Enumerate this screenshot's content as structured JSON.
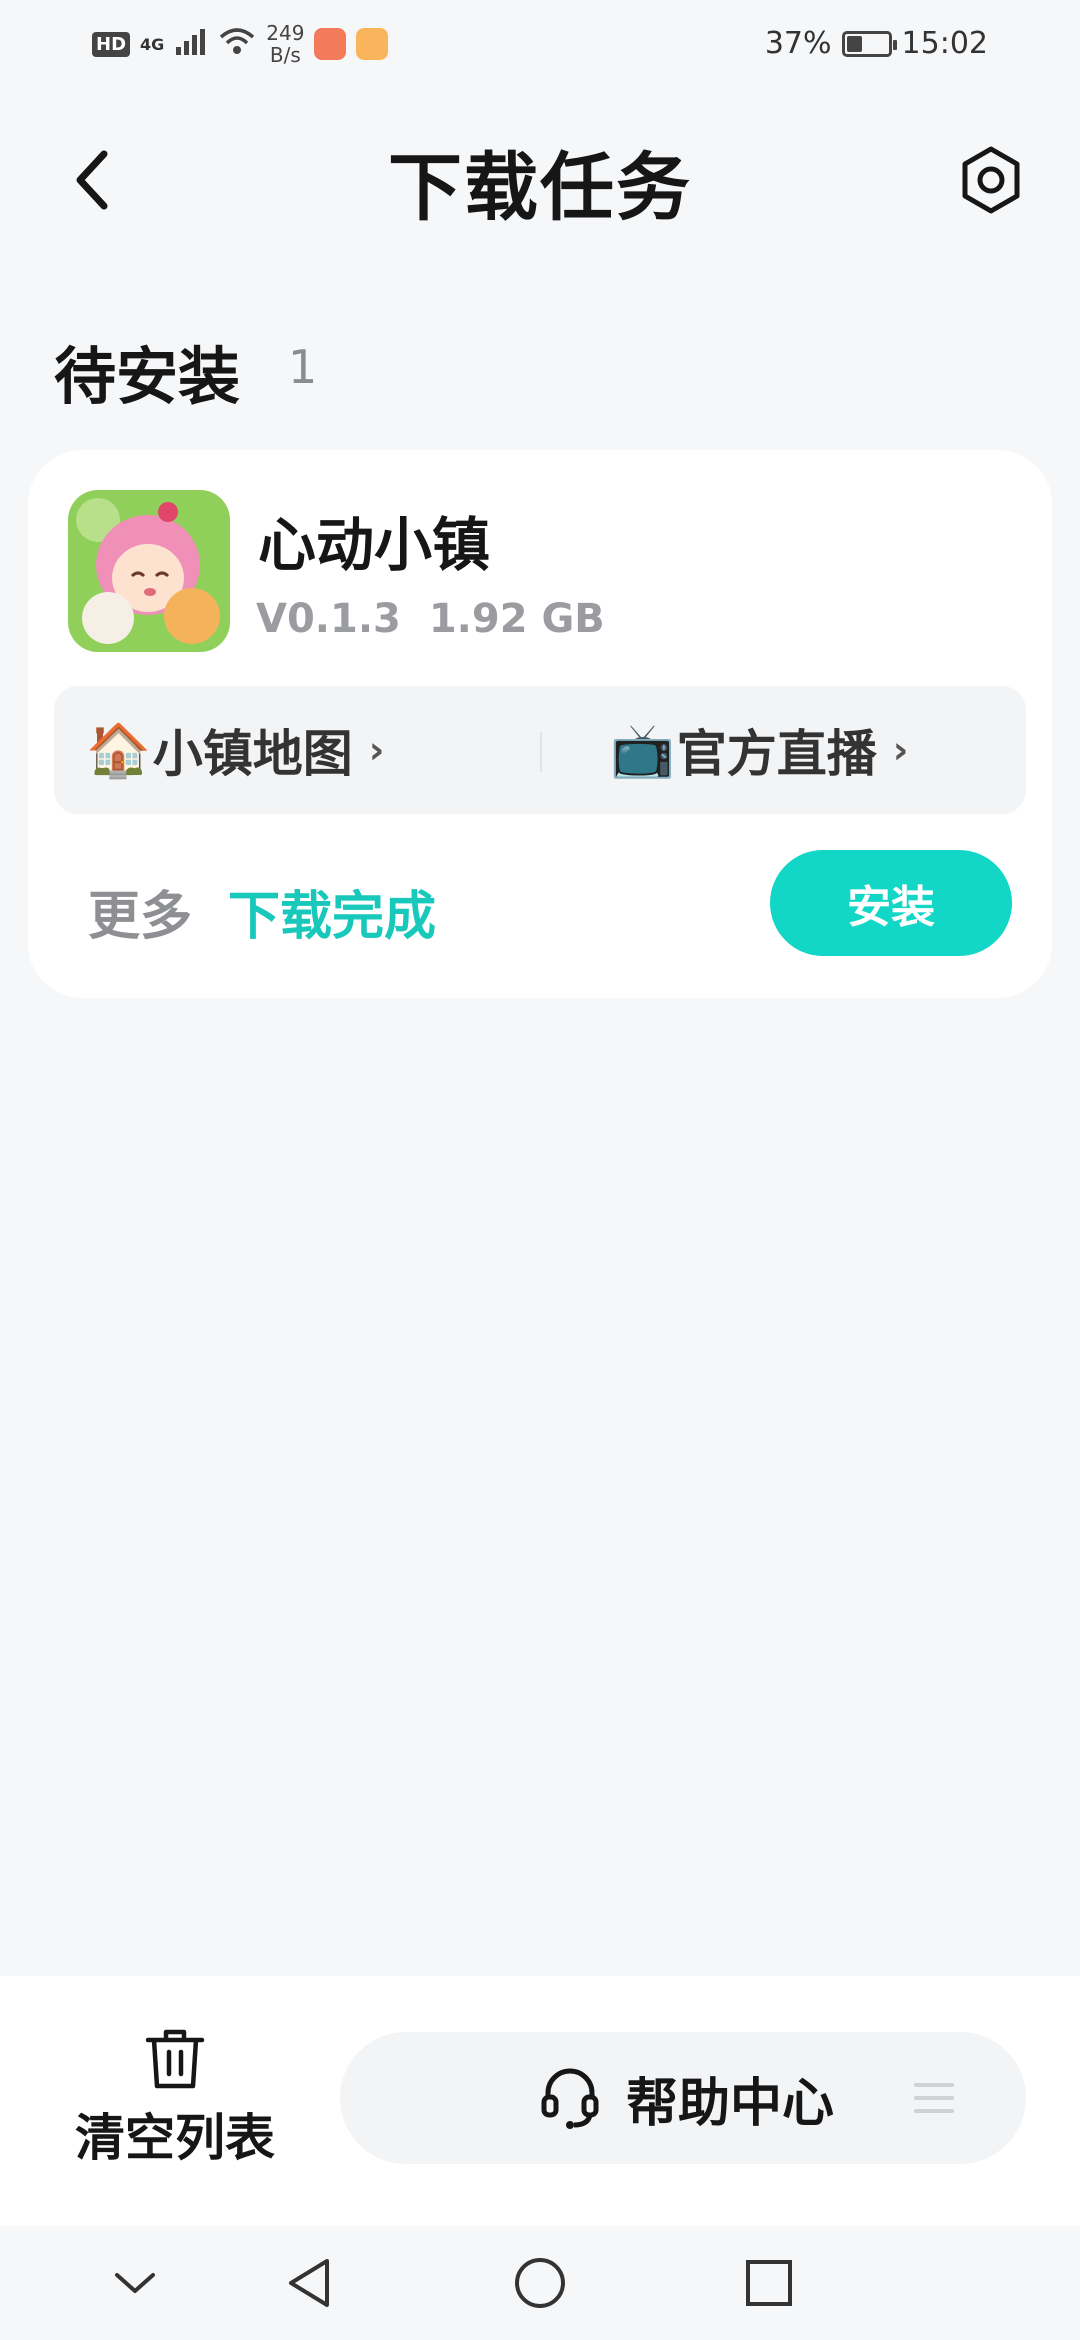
{
  "status_bar": {
    "hd": "HD",
    "network": "4G",
    "speed_value": "249",
    "speed_unit": "B/s",
    "battery": "37%",
    "battery_level": 0.37,
    "time": "15:02"
  },
  "header": {
    "title": "下载任务",
    "back_icon": "chevron-left-icon",
    "settings_icon": "gear-icon"
  },
  "section": {
    "title": "待安装",
    "count": "1"
  },
  "task": {
    "app_name": "心动小镇",
    "version": "V0.1.3",
    "size": "1.92 GB",
    "links": [
      {
        "emoji": "🏠",
        "label": "小镇地图",
        "chevron": "›"
      },
      {
        "emoji": "📺",
        "label": "官方直播",
        "chevron": "›"
      }
    ],
    "more_label": "更多",
    "status": "下载完成",
    "install_label": "安装"
  },
  "bottom": {
    "clear_label": "清空列表",
    "help_label": "帮助中心"
  },
  "colors": {
    "accent": "#12d6c6",
    "status_text": "#17c8bb",
    "background": "#f6f7f9"
  }
}
